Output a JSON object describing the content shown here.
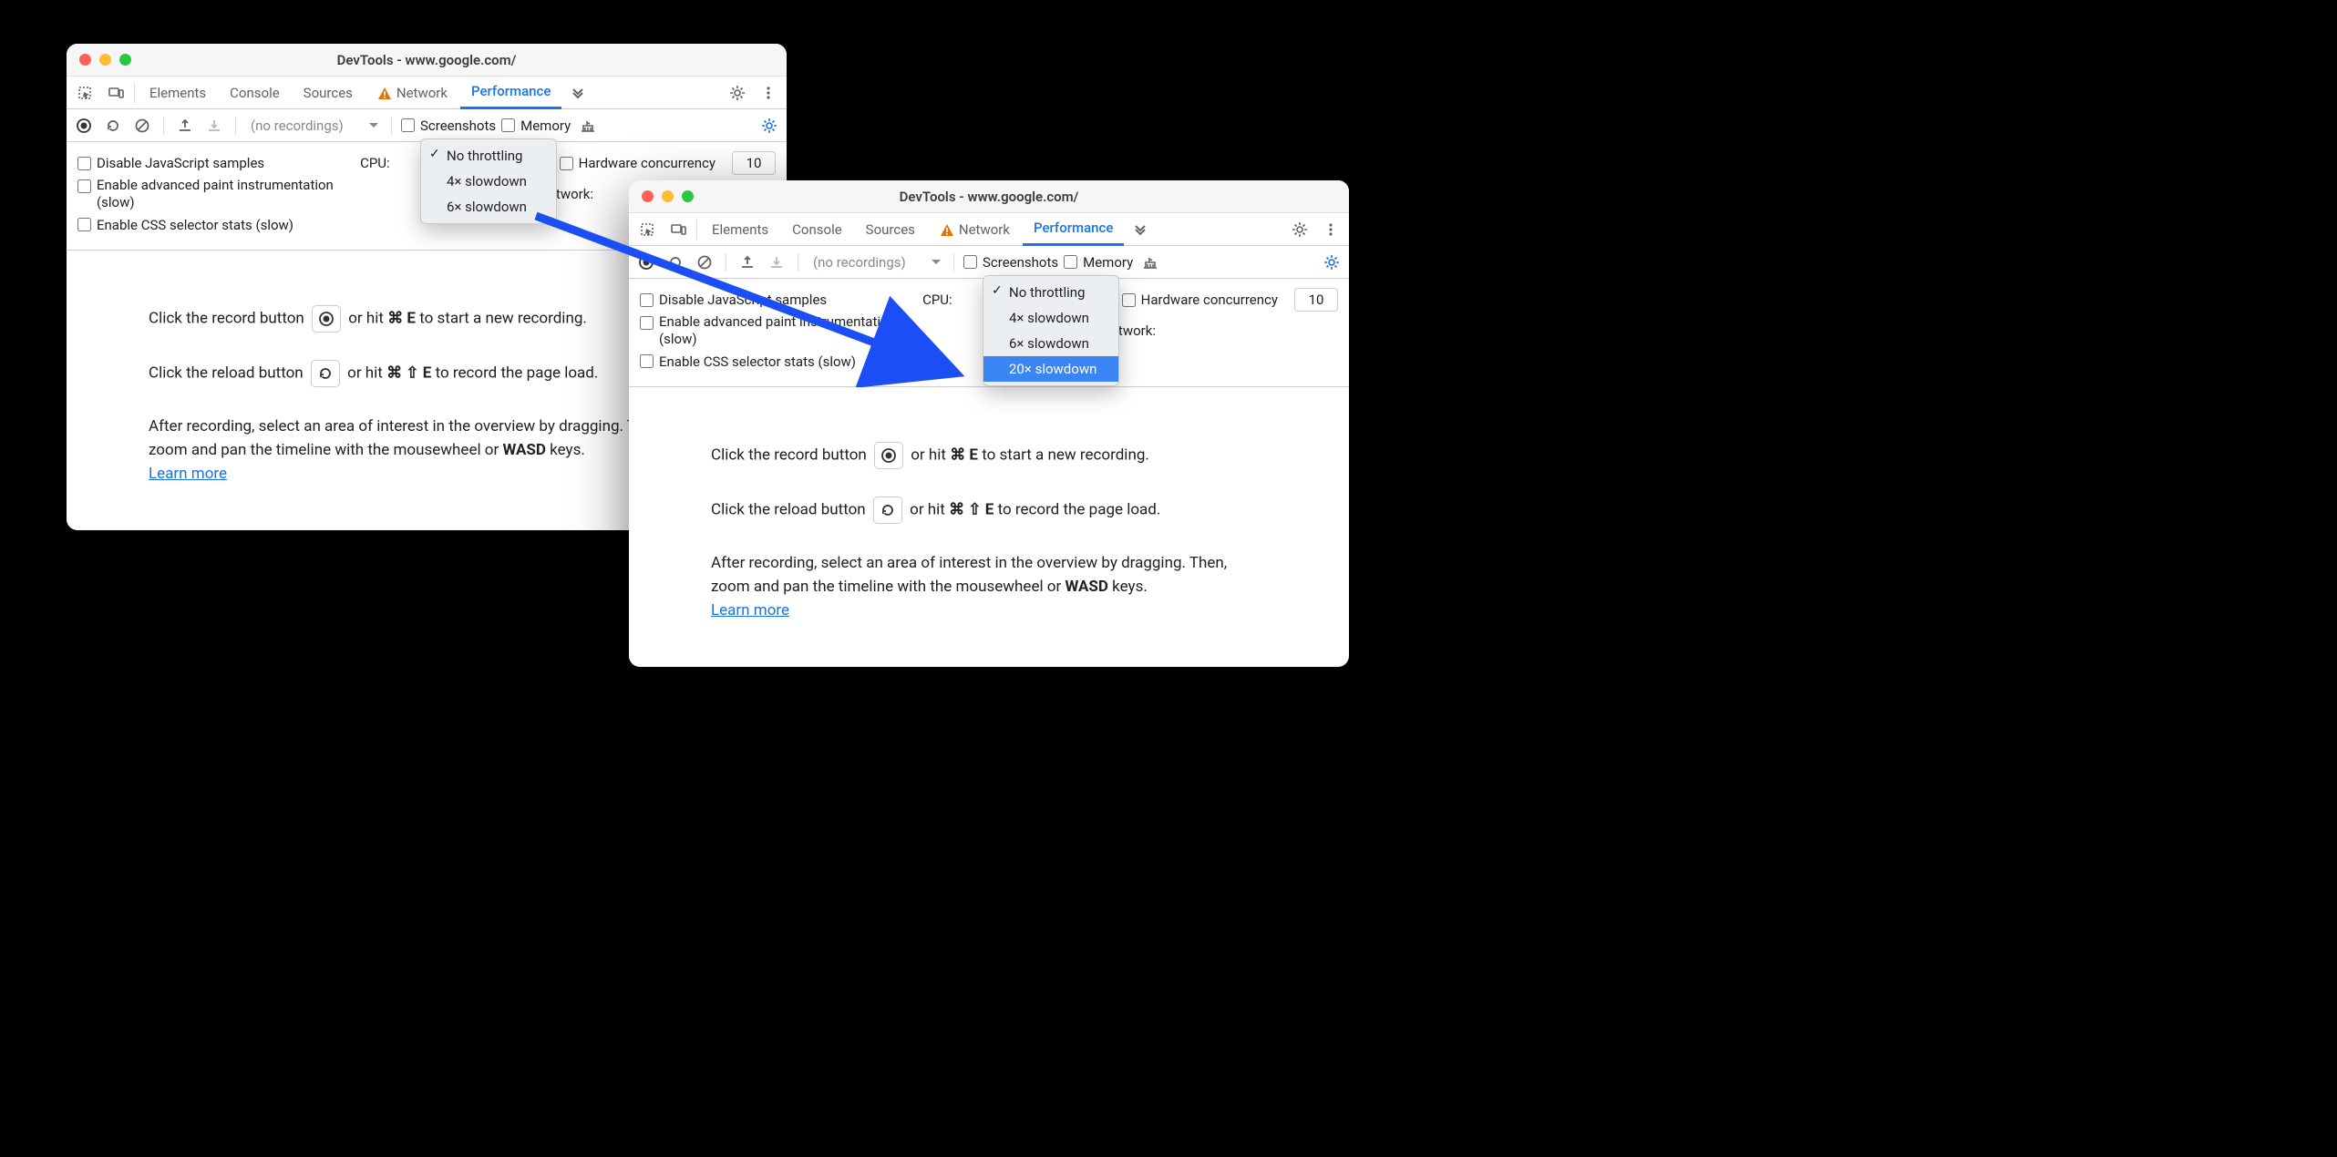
{
  "window_title": "DevTools - www.google.com/",
  "tabs": {
    "elements": "Elements",
    "console": "Console",
    "sources": "Sources",
    "network": "Network",
    "performance": "Performance"
  },
  "toolbar": {
    "no_recordings": "(no recordings)",
    "screenshots": "Screenshots",
    "memory": "Memory"
  },
  "settings": {
    "disable_js": "Disable JavaScript samples",
    "advanced_paint": "Enable advanced paint instrumentation (slow)",
    "css_selector": "Enable CSS selector stats (slow)",
    "cpu": "CPU:",
    "network": "Network:",
    "hw_concurrency": "Hardware concurrency",
    "hw_value": "10"
  },
  "cpu_dropdown_a": {
    "items": [
      "No throttling",
      "4× slowdown",
      "6× slowdown"
    ],
    "checked": 0,
    "selected": -1
  },
  "cpu_dropdown_b": {
    "items": [
      "No throttling",
      "4× slowdown",
      "6× slowdown",
      "20× slowdown"
    ],
    "checked": 0,
    "selected": 3
  },
  "instructions": {
    "line1a": "Click the record button ",
    "line1b": " or hit ",
    "line1c": " to start a new recording.",
    "shortcut1": "⌘ E",
    "line2a": "Click the reload button ",
    "line2b": " or hit ",
    "line2c_a": " to record the page load.",
    "line2c_b": " to record the page load.",
    "shortcut2": "⌘ ⇧ E",
    "para_a": "After recording, select an area of interest in the overview by dragging. Then, zoom and pan the timeline with the mousewheel or ",
    "wasd_a": "WASD",
    "tail_a": " keys. ",
    "para_b": "After recording, select an area of interest in the overview by dragging. Then, zoom and pan the timeline with the mousewheel or ",
    "wasd_b": "WASD",
    "tail_b": " keys.",
    "learn": "Learn more"
  }
}
